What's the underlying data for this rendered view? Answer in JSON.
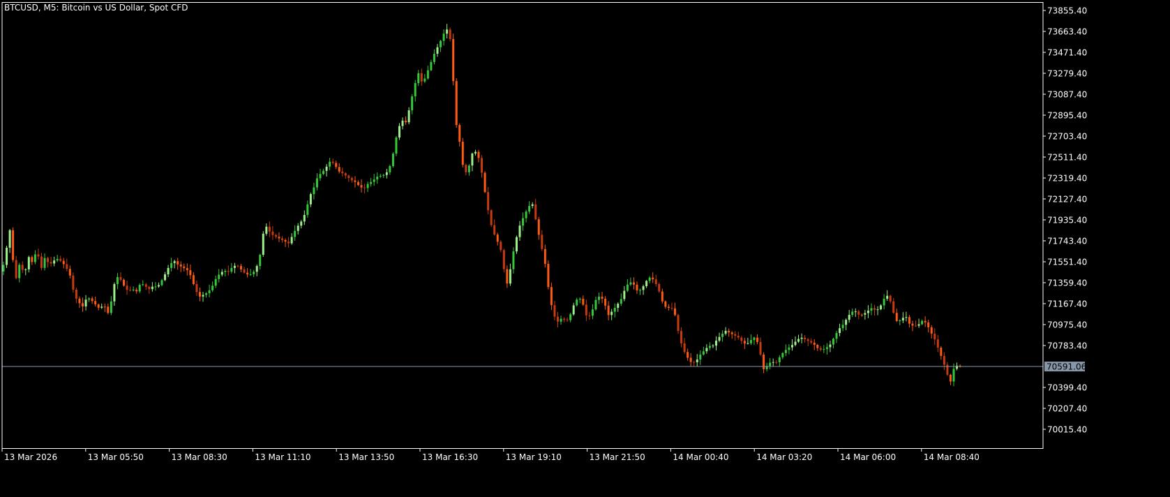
{
  "title": "BTCUSD, M5:  Bitcoin vs US Dollar, Spot CFD",
  "colors": {
    "background": "#000000",
    "frame": "#ffffff",
    "bull": "#35c83a",
    "bull_light": "#9cf08a",
    "bear": "#ff5a14",
    "bear_dark": "#c83a0f",
    "price_line": "#8796a8",
    "price_label_bg": "#8796a8"
  },
  "chart_data": {
    "type": "candlestick",
    "symbol": "BTCUSD",
    "timeframe": "M5",
    "ylim": [
      69920,
      73900
    ],
    "yticks": [
      "73855.40",
      "73663.40",
      "73471.40",
      "73279.40",
      "73087.40",
      "72895.40",
      "72703.40",
      "72511.40",
      "72319.40",
      "72127.40",
      "71935.40",
      "71743.40",
      "71551.40",
      "71359.40",
      "71167.40",
      "70975.40",
      "70783.40",
      "70591.06",
      "70399.40",
      "70207.40",
      "70015.40"
    ],
    "xticks": [
      "13 Mar 2026",
      "13 Mar 05:50",
      "13 Mar 08:30",
      "13 Mar 11:10",
      "13 Mar 13:50",
      "13 Mar 16:30",
      "13 Mar 19:10",
      "13 Mar 21:50",
      "14 Mar 00:40",
      "14 Mar 03:20",
      "14 Mar 06:00",
      "14 Mar 08:40"
    ],
    "current_price": 70591.06,
    "current_price_label": "70591.06",
    "grid": false,
    "path": [
      [
        0,
        71080
      ],
      [
        4,
        71640
      ],
      [
        9,
        71460
      ],
      [
        15,
        71930
      ],
      [
        20,
        71600
      ],
      [
        26,
        71380
      ],
      [
        31,
        71560
      ],
      [
        37,
        71420
      ],
      [
        43,
        71600
      ],
      [
        49,
        71540
      ],
      [
        55,
        71670
      ],
      [
        61,
        71480
      ],
      [
        67,
        71600
      ],
      [
        73,
        71520
      ],
      [
        79,
        71560
      ],
      [
        85,
        71580
      ],
      [
        91,
        71550
      ],
      [
        97,
        71500
      ],
      [
        103,
        71420
      ],
      [
        109,
        71240
      ],
      [
        115,
        71180
      ],
      [
        121,
        71140
      ],
      [
        127,
        71230
      ],
      [
        133,
        71200
      ],
      [
        139,
        71160
      ],
      [
        145,
        71120
      ],
      [
        151,
        71160
      ],
      [
        157,
        71080
      ],
      [
        163,
        71220
      ],
      [
        168,
        71420
      ],
      [
        174,
        71400
      ],
      [
        180,
        71330
      ],
      [
        186,
        71280
      ],
      [
        192,
        71300
      ],
      [
        198,
        71280
      ],
      [
        204,
        71360
      ],
      [
        210,
        71330
      ],
      [
        216,
        71300
      ],
      [
        222,
        71330
      ],
      [
        228,
        71320
      ],
      [
        234,
        71380
      ],
      [
        240,
        71450
      ],
      [
        246,
        71530
      ],
      [
        252,
        71560
      ],
      [
        258,
        71520
      ],
      [
        264,
        71500
      ],
      [
        270,
        71480
      ],
      [
        276,
        71420
      ],
      [
        282,
        71300
      ],
      [
        288,
        71230
      ],
      [
        294,
        71250
      ],
      [
        300,
        71270
      ],
      [
        306,
        71320
      ],
      [
        312,
        71400
      ],
      [
        318,
        71450
      ],
      [
        324,
        71470
      ],
      [
        330,
        71460
      ],
      [
        336,
        71510
      ],
      [
        342,
        71520
      ],
      [
        348,
        71480
      ],
      [
        354,
        71440
      ],
      [
        360,
        71430
      ],
      [
        366,
        71460
      ],
      [
        372,
        71530
      ],
      [
        378,
        71700
      ],
      [
        381,
        71910
      ],
      [
        386,
        71850
      ],
      [
        392,
        71800
      ],
      [
        398,
        71780
      ],
      [
        404,
        71760
      ],
      [
        410,
        71740
      ],
      [
        416,
        71720
      ],
      [
        422,
        71800
      ],
      [
        428,
        71870
      ],
      [
        434,
        71920
      ],
      [
        440,
        72000
      ],
      [
        446,
        72150
      ],
      [
        452,
        72230
      ],
      [
        458,
        72340
      ],
      [
        464,
        72370
      ],
      [
        470,
        72420
      ],
      [
        476,
        72480
      ],
      [
        482,
        72440
      ],
      [
        488,
        72380
      ],
      [
        494,
        72360
      ],
      [
        500,
        72330
      ],
      [
        506,
        72300
      ],
      [
        512,
        72280
      ],
      [
        518,
        72240
      ],
      [
        524,
        72220
      ],
      [
        530,
        72270
      ],
      [
        536,
        72290
      ],
      [
        542,
        72330
      ],
      [
        548,
        72340
      ],
      [
        554,
        72350
      ],
      [
        560,
        72400
      ],
      [
        566,
        72550
      ],
      [
        572,
        72750
      ],
      [
        578,
        72850
      ],
      [
        584,
        72830
      ],
      [
        590,
        72980
      ],
      [
        596,
        73160
      ],
      [
        602,
        73280
      ],
      [
        608,
        73180
      ],
      [
        614,
        73280
      ],
      [
        620,
        73380
      ],
      [
        626,
        73480
      ],
      [
        632,
        73550
      ],
      [
        638,
        73640
      ],
      [
        644,
        73690
      ],
      [
        650,
        73520
      ],
      [
        654,
        72880
      ],
      [
        660,
        72700
      ],
      [
        666,
        72420
      ],
      [
        672,
        72350
      ],
      [
        678,
        72540
      ],
      [
        684,
        72560
      ],
      [
        690,
        72480
      ],
      [
        696,
        72240
      ],
      [
        702,
        72020
      ],
      [
        708,
        71840
      ],
      [
        714,
        71760
      ],
      [
        720,
        71660
      ],
      [
        726,
        71430
      ],
      [
        730,
        71330
      ],
      [
        736,
        71580
      ],
      [
        742,
        71760
      ],
      [
        748,
        71900
      ],
      [
        754,
        71980
      ],
      [
        760,
        72060
      ],
      [
        766,
        72080
      ],
      [
        772,
        71870
      ],
      [
        778,
        71700
      ],
      [
        784,
        71520
      ],
      [
        790,
        71230
      ],
      [
        796,
        71060
      ],
      [
        802,
        71000
      ],
      [
        808,
        71040
      ],
      [
        814,
        71000
      ],
      [
        820,
        71070
      ],
      [
        826,
        71180
      ],
      [
        832,
        71230
      ],
      [
        838,
        71160
      ],
      [
        844,
        71030
      ],
      [
        850,
        71080
      ],
      [
        856,
        71200
      ],
      [
        862,
        71240
      ],
      [
        868,
        71190
      ],
      [
        874,
        71060
      ],
      [
        880,
        71100
      ],
      [
        886,
        71150
      ],
      [
        892,
        71200
      ],
      [
        898,
        71300
      ],
      [
        904,
        71370
      ],
      [
        910,
        71350
      ],
      [
        916,
        71280
      ],
      [
        922,
        71300
      ],
      [
        928,
        71370
      ],
      [
        934,
        71410
      ],
      [
        940,
        71380
      ],
      [
        946,
        71300
      ],
      [
        952,
        71180
      ],
      [
        958,
        71120
      ],
      [
        964,
        71140
      ],
      [
        970,
        71060
      ],
      [
        976,
        70860
      ],
      [
        982,
        70740
      ],
      [
        988,
        70670
      ],
      [
        994,
        70620
      ],
      [
        1000,
        70640
      ],
      [
        1006,
        70700
      ],
      [
        1012,
        70740
      ],
      [
        1018,
        70780
      ],
      [
        1024,
        70780
      ],
      [
        1030,
        70840
      ],
      [
        1036,
        70880
      ],
      [
        1042,
        70920
      ],
      [
        1048,
        70900
      ],
      [
        1054,
        70880
      ],
      [
        1060,
        70860
      ],
      [
        1066,
        70820
      ],
      [
        1072,
        70790
      ],
      [
        1078,
        70830
      ],
      [
        1084,
        70860
      ],
      [
        1090,
        70790
      ],
      [
        1096,
        70560
      ],
      [
        1102,
        70600
      ],
      [
        1108,
        70640
      ],
      [
        1114,
        70620
      ],
      [
        1120,
        70680
      ],
      [
        1126,
        70730
      ],
      [
        1132,
        70760
      ],
      [
        1138,
        70790
      ],
      [
        1144,
        70830
      ],
      [
        1150,
        70860
      ],
      [
        1156,
        70840
      ],
      [
        1162,
        70820
      ],
      [
        1168,
        70800
      ],
      [
        1174,
        70760
      ],
      [
        1180,
        70740
      ],
      [
        1186,
        70760
      ],
      [
        1192,
        70790
      ],
      [
        1198,
        70860
      ],
      [
        1204,
        70930
      ],
      [
        1210,
        70970
      ],
      [
        1216,
        71030
      ],
      [
        1222,
        71090
      ],
      [
        1228,
        71100
      ],
      [
        1234,
        71060
      ],
      [
        1240,
        71070
      ],
      [
        1246,
        71100
      ],
      [
        1252,
        71130
      ],
      [
        1258,
        71100
      ],
      [
        1264,
        71140
      ],
      [
        1270,
        71220
      ],
      [
        1276,
        71250
      ],
      [
        1282,
        71100
      ],
      [
        1288,
        71000
      ],
      [
        1294,
        71020
      ],
      [
        1300,
        71060
      ],
      [
        1306,
        70980
      ],
      [
        1312,
        70960
      ],
      [
        1318,
        70970
      ],
      [
        1324,
        71010
      ],
      [
        1330,
        70990
      ],
      [
        1336,
        70910
      ],
      [
        1342,
        70840
      ],
      [
        1348,
        70740
      ],
      [
        1354,
        70640
      ],
      [
        1360,
        70520
      ],
      [
        1364,
        70430
      ],
      [
        1368,
        70560
      ],
      [
        1373,
        70600
      ],
      [
        1377,
        70591
      ]
    ]
  }
}
